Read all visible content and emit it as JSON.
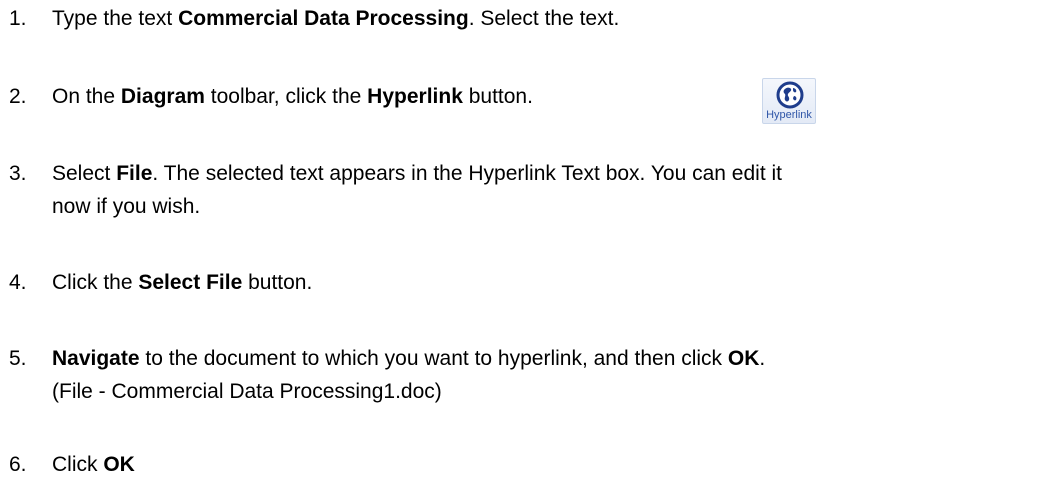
{
  "steps": [
    {
      "number": "1.",
      "parts": [
        {
          "text": "Type the text ",
          "bold": false
        },
        {
          "text": "Commercial Data Processing",
          "bold": true
        },
        {
          "text": ". Select the text.",
          "bold": false
        }
      ]
    },
    {
      "number": "2.",
      "parts": [
        {
          "text": "On the ",
          "bold": false
        },
        {
          "text": "Diagram",
          "bold": true
        },
        {
          "text": " toolbar, click the ",
          "bold": false
        },
        {
          "text": "Hyperlink",
          "bold": true
        },
        {
          "text": " button.",
          "bold": false
        }
      ]
    },
    {
      "number": "3.",
      "lines": [
        [
          {
            "text": "Select ",
            "bold": false
          },
          {
            "text": "File",
            "bold": true
          },
          {
            "text": ". The selected text appears in the Hyperlink Text box. You can edit it",
            "bold": false
          }
        ],
        [
          {
            "text": "now if you wish.",
            "bold": false
          }
        ]
      ]
    },
    {
      "number": "4.",
      "parts": [
        {
          "text": "Click the ",
          "bold": false
        },
        {
          "text": "Select File",
          "bold": true
        },
        {
          "text": " button.",
          "bold": false
        }
      ]
    },
    {
      "number": "5.",
      "lines": [
        [
          {
            "text": "Navigate",
            "bold": true
          },
          {
            "text": " to the document to which you want to hyperlink, and then click ",
            "bold": false
          },
          {
            "text": "OK",
            "bold": true
          },
          {
            "text": ".",
            "bold": false
          }
        ],
        [
          {
            "text": "(File - Commercial Data Processing1.doc)",
            "bold": false
          }
        ]
      ]
    },
    {
      "number": "6.",
      "parts": [
        {
          "text": "Click ",
          "bold": false
        },
        {
          "text": "OK",
          "bold": true
        }
      ]
    }
  ],
  "hyperlink_button": {
    "label": "Hyperlink",
    "icon": "globe-link-icon",
    "label_color": "#2f56a8",
    "icon_color": "#1f3d8c"
  }
}
